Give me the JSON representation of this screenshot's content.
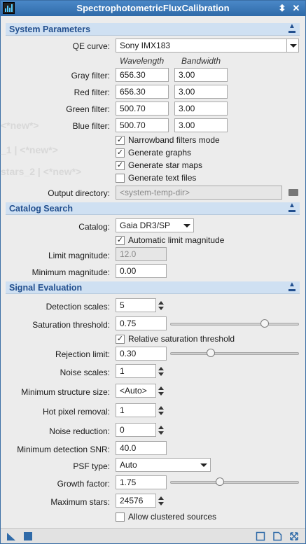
{
  "window": {
    "title": "SpectrophotometricFluxCalibration"
  },
  "ghost_lines": [
    "<*new*>",
    "_1 | <*new*>",
    "stars_2 | <*new*>"
  ],
  "system": {
    "header": "System Parameters",
    "qe_curve_label": "QE curve:",
    "qe_curve_value": "Sony IMX183",
    "col_wavelength": "Wavelength",
    "col_bandwidth": "Bandwidth",
    "filters": [
      {
        "label": "Gray filter:",
        "wavelength": "656.30",
        "bandwidth": "3.00"
      },
      {
        "label": "Red filter:",
        "wavelength": "656.30",
        "bandwidth": "3.00"
      },
      {
        "label": "Green filter:",
        "wavelength": "500.70",
        "bandwidth": "3.00"
      },
      {
        "label": "Blue filter:",
        "wavelength": "500.70",
        "bandwidth": "3.00"
      }
    ],
    "checks": [
      {
        "label": "Narrowband filters mode",
        "checked": true
      },
      {
        "label": "Generate graphs",
        "checked": true
      },
      {
        "label": "Generate star maps",
        "checked": true
      },
      {
        "label": "Generate text files",
        "checked": false
      }
    ],
    "output_dir_label": "Output directory:",
    "output_dir_placeholder": "<system-temp-dir>"
  },
  "catalog": {
    "header": "Catalog Search",
    "catalog_label": "Catalog:",
    "catalog_value": "Gaia DR3/SP",
    "auto_limit_label": "Automatic limit magnitude",
    "auto_limit_checked": true,
    "limit_mag_label": "Limit magnitude:",
    "limit_mag_value": "12.0",
    "min_mag_label": "Minimum magnitude:",
    "min_mag_value": "0.00"
  },
  "signal": {
    "header": "Signal Evaluation",
    "detection_scales_label": "Detection scales:",
    "detection_scales_value": "5",
    "saturation_label": "Saturation threshold:",
    "saturation_value": "0.75",
    "saturation_slider": 0.75,
    "relative_sat_label": "Relative saturation threshold",
    "relative_sat_checked": true,
    "rejection_label": "Rejection limit:",
    "rejection_value": "0.30",
    "rejection_slider": 0.3,
    "noise_scales_label": "Noise scales:",
    "noise_scales_value": "1",
    "min_structure_label": "Minimum structure size:",
    "min_structure_value": "<Auto>",
    "hot_pixel_label": "Hot pixel removal:",
    "hot_pixel_value": "1",
    "noise_reduction_label": "Noise reduction:",
    "noise_reduction_value": "0",
    "min_snr_label": "Minimum detection SNR:",
    "min_snr_value": "40.0",
    "psf_type_label": "PSF type:",
    "psf_type_value": "Auto",
    "growth_label": "Growth factor:",
    "growth_value": "1.75",
    "growth_slider": 0.38,
    "max_stars_label": "Maximum stars:",
    "max_stars_value": "24576",
    "allow_clustered_label": "Allow clustered sources",
    "allow_clustered_checked": false
  },
  "icons": {
    "app": "pixinsight-process-icon",
    "collapse": "collapse-section-icon",
    "folder": "folder-icon",
    "new_instance": "new-instance-triangle-icon",
    "apply_global": "apply-global-square-icon",
    "preview": "preview-square-icon",
    "document": "document-icon",
    "reset": "reset-arrows-icon"
  },
  "colors": {
    "titlebar": "#3a79bb",
    "section_header_bg": "#cfe0f2",
    "section_header_text": "#23508f"
  }
}
